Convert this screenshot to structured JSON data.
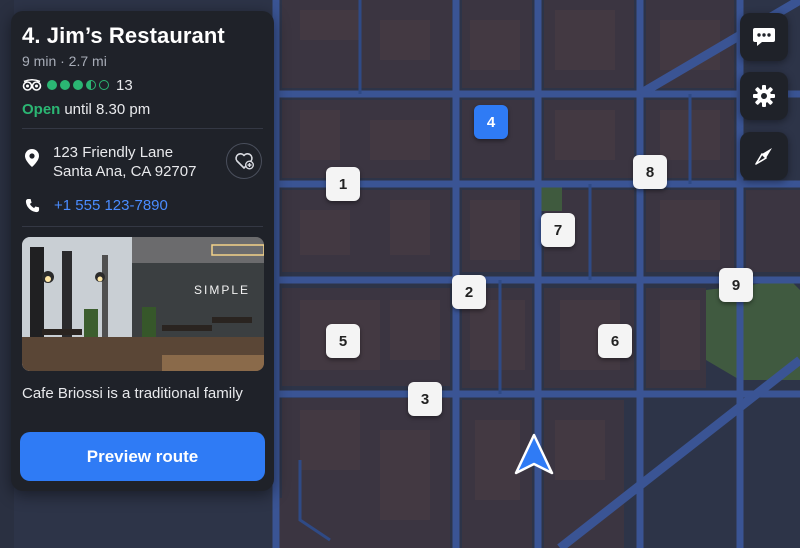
{
  "place": {
    "title": "4. Jim’s Restaurant",
    "subtitle": "9 min · 2.7 mi",
    "review_count": "13",
    "rating": 3.5,
    "rating_max": 5,
    "status": "Open",
    "hours": "until 8.30 pm",
    "address_line1": "123 Friendly Lane",
    "address_line2": "Santa Ana, CA 92707",
    "phone": "+1 555 123-7890",
    "photo_sign": "SIMPLE",
    "description": "Cafe Briossi is a traditional family",
    "route_button": "Preview route"
  },
  "map_markers": [
    {
      "label": "1"
    },
    {
      "label": "2"
    },
    {
      "label": "3"
    },
    {
      "label": "4",
      "selected": true
    },
    {
      "label": "5"
    },
    {
      "label": "6"
    },
    {
      "label": "7"
    },
    {
      "label": "8"
    },
    {
      "label": "9"
    }
  ],
  "side_buttons": [
    "chat-icon",
    "settings-gear-icon",
    "compass-icon"
  ],
  "colors": {
    "accent": "#2f7bf5",
    "open": "#2bb673",
    "panel": "#1f2229",
    "map_block": "#3a3440",
    "map_street": "#3b5592"
  }
}
